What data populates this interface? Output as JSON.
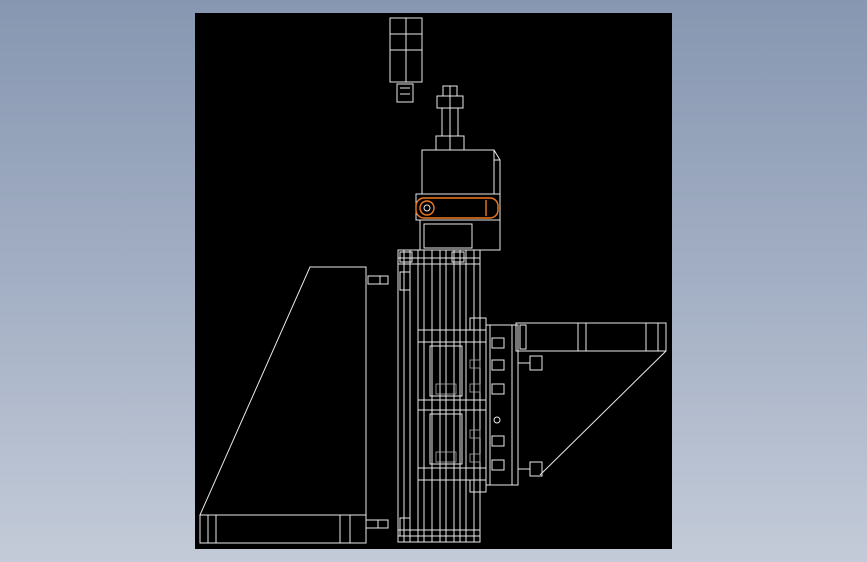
{
  "colors": {
    "background_top": "#8797b1",
    "background_bottom": "#c3cbd8",
    "sheet": "#000000",
    "line": "#e8e8e8",
    "highlight": "#f07a20"
  }
}
